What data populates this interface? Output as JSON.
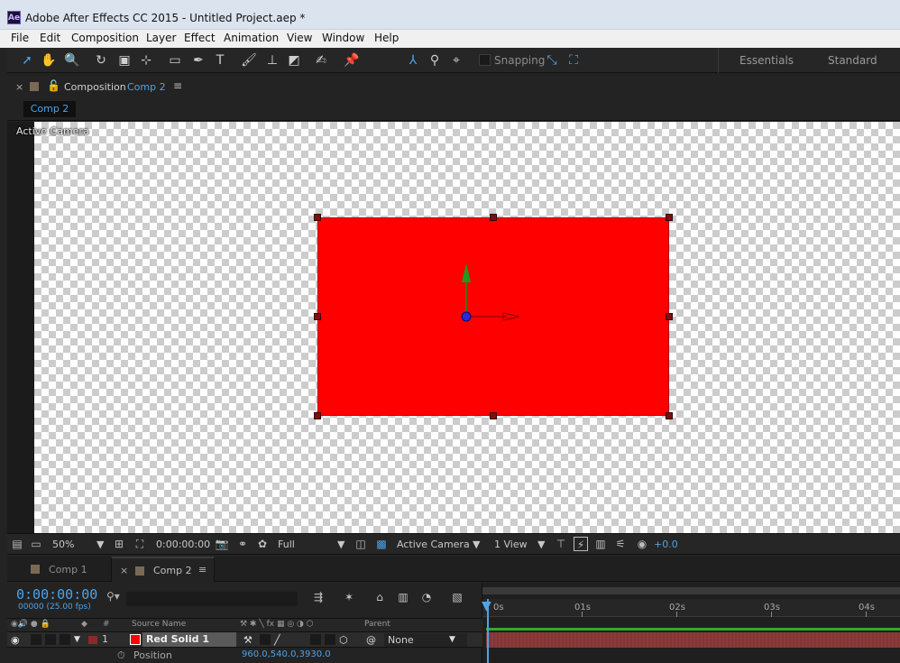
{
  "window": {
    "title": "Adobe After Effects CC 2015 - Untitled Project.aep *",
    "app_badge": "Ae"
  },
  "menubar": {
    "items": [
      "File",
      "Edit",
      "Composition",
      "Layer",
      "Effect",
      "Animation",
      "View",
      "Window",
      "Help"
    ]
  },
  "toolbar": {
    "snapping_label": "Snapping",
    "workspaces": [
      "Essentials",
      "Standard"
    ],
    "tools": [
      "selection-tool",
      "hand-tool",
      "zoom-tool",
      "rotate-tool",
      "unified-camera-tool",
      "pan-behind-tool",
      "rectangle-tool",
      "pen-tool",
      "type-tool",
      "brush-tool",
      "clone-stamp-tool",
      "eraser-tool",
      "roto-brush-tool",
      "puppet-pin-tool",
      "local-axis-mode",
      "world-axis-mode",
      "view-axis-mode"
    ]
  },
  "comp_panel": {
    "panel_label": "Composition",
    "comp_name": "Comp 2",
    "breadcrumb": "Comp 2",
    "viewer_label": "Active Camera",
    "solid_color": "#fe0000"
  },
  "viewer_bar": {
    "magnification": "50%",
    "timecode": "0:00:00:00",
    "resolution": "Full",
    "view": "Active Camera",
    "layout": "1 View",
    "exposure": "+0.0"
  },
  "timeline": {
    "tabs": [
      {
        "label": "Comp 1"
      },
      {
        "label": "Comp 2"
      }
    ],
    "timecode": "0:00:00:00",
    "fps": "00000 (25.00 fps)",
    "columns": {
      "num": "#",
      "source_name": "Source Name",
      "parent": "Parent"
    },
    "layer": {
      "index": "1",
      "name": "Red Solid 1",
      "parent": "None"
    },
    "property": {
      "name": "Position",
      "value": "960.0,540.0,3930.0"
    },
    "ruler_labels": [
      "0s",
      "01s",
      "02s",
      "03s",
      "04s"
    ]
  },
  "colors": {
    "accent": "#4ea3e8",
    "label_red": "#8c3a3a",
    "work_green": "#34a82c"
  }
}
